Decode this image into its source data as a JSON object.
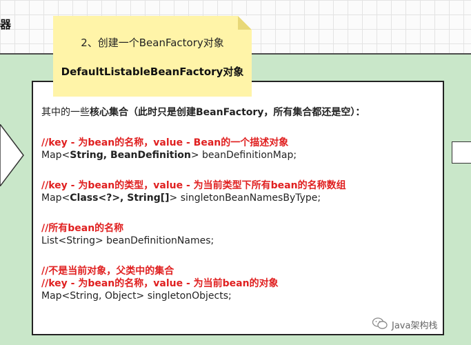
{
  "header": {
    "title_fragment": "器"
  },
  "note": {
    "line1": "2、创建一个BeanFactory对象",
    "line2": "DefaultListableBeanFactory对象"
  },
  "content": {
    "intro": {
      "plain": "其中的一些",
      "bold": "核心集合（此时只是创建BeanFactory，所有集合都还是空）："
    },
    "comment1": "//key - 为bean的名称，value - Bean的一个描述对象",
    "code1": {
      "prefix": "Map<",
      "bold": "String, BeanDefinition",
      "suffix": "> beanDefinitionMap;"
    },
    "comment2": "//key - 为bean的类型，value - 为当前类型下所有bean的名称数组",
    "code2": {
      "prefix": "Map<",
      "bold": "Class<?>, String[]",
      "suffix": "> singletonBeanNamesByType;"
    },
    "comment3": "//所有bean的名称",
    "code3": "List<String> beanDefinitionNames;",
    "comment4a": "//不是当前对象，父类中的集合",
    "comment4b": "//key - 为bean的名称，value - 为当前bean的对象",
    "code4": "Map<String, Object> singletonObjects;"
  },
  "watermark": {
    "text": "Java架构栈",
    "icon": "wechat-icon"
  },
  "colors": {
    "comment_red": "#e02020",
    "panel_green": "#c9e7c9",
    "note_yellow": "#fff4a8"
  }
}
